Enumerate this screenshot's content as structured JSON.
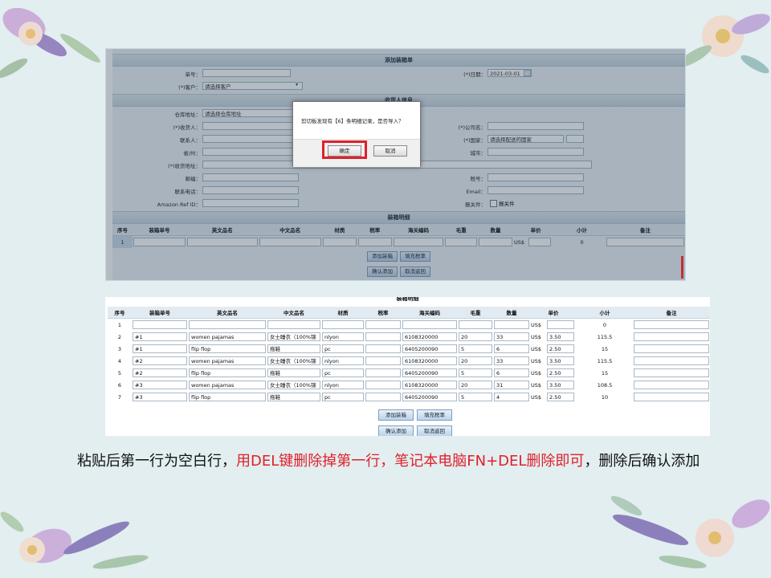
{
  "form": {
    "title": "添加装箱单",
    "order_no_label": "单号：",
    "date_label": "(*)日期：",
    "date_value": "2021-03-01",
    "customer_label": "(*)客户：",
    "customer_value": "请选择客户",
    "receiver_title": "收货人信息",
    "warehouse_label": "仓库地址：",
    "warehouse_value": "请选择仓库地址",
    "receiver_label": "(*)收货人：",
    "company_label": "(*)公司名：",
    "contact_label": "联系人：",
    "country_label": "(*)国家：",
    "country_value": "请选择配送的国家",
    "province_label": "省/州：",
    "city_label": "城市：",
    "address_label": "(*)收货地址：",
    "zip_label": "邮编：",
    "tax_no_label": "税号：",
    "phone_label": "联系电话：",
    "email_label": "Email：",
    "amazon_label": "Amazon Ref ID：",
    "customs_label": "报关件：",
    "customs_checkbox": "报关件",
    "detail_title": "装箱明细",
    "row1_index": "1",
    "row1_currency": "US$",
    "row1_subtotal": "0"
  },
  "dialog": {
    "message": "剪切板发现有【6】条明细记录，是否导入？",
    "ok": "确定",
    "cancel": "取消"
  },
  "table": {
    "title": "装箱明细",
    "headers": [
      "序号",
      "装箱单号",
      "英文品名",
      "中文品名",
      "材质",
      "税率",
      "海关编码",
      "毛重",
      "数量",
      "单价",
      "小计",
      "备注"
    ],
    "rows": [
      {
        "idx": "1",
        "box": "",
        "en": "",
        "cn": "",
        "mat": "",
        "tax": "",
        "hs": "",
        "weight": "",
        "qty": "",
        "cur": "US$",
        "price": "",
        "sub": "0"
      },
      {
        "idx": "2",
        "box": "#1",
        "en": "women pajamas",
        "cn": "女士睡衣（100%锦",
        "mat": "nlyon",
        "tax": "",
        "hs": "6108320000",
        "weight": "20",
        "qty": "33",
        "cur": "US$",
        "price": "3.50",
        "sub": "115.5"
      },
      {
        "idx": "3",
        "box": "#1",
        "en": "flip flop",
        "cn": "拖鞋",
        "mat": "pc",
        "tax": "",
        "hs": "6405200090",
        "weight": "5",
        "qty": "6",
        "cur": "US$",
        "price": "2.50",
        "sub": "15"
      },
      {
        "idx": "4",
        "box": "#2",
        "en": "women pajamas",
        "cn": "女士睡衣（100%锦",
        "mat": "nlyon",
        "tax": "",
        "hs": "6108320000",
        "weight": "20",
        "qty": "33",
        "cur": "US$",
        "price": "3.50",
        "sub": "115.5"
      },
      {
        "idx": "5",
        "box": "#2",
        "en": "flip flop",
        "cn": "拖鞋",
        "mat": "pc",
        "tax": "",
        "hs": "6405200090",
        "weight": "5",
        "qty": "6",
        "cur": "US$",
        "price": "2.50",
        "sub": "15"
      },
      {
        "idx": "6",
        "box": "#3",
        "en": "women pajamas",
        "cn": "女士睡衣（100%锦",
        "mat": "nlyon",
        "tax": "",
        "hs": "6108320000",
        "weight": "20",
        "qty": "31",
        "cur": "US$",
        "price": "3.50",
        "sub": "108.5"
      },
      {
        "idx": "7",
        "box": "#3",
        "en": "flip flop",
        "cn": "拖鞋",
        "mat": "pc",
        "tax": "",
        "hs": "6405200090",
        "weight": "5",
        "qty": "4",
        "cur": "US$",
        "price": "2.50",
        "sub": "10"
      }
    ]
  },
  "buttons": {
    "add_box": "添加装箱",
    "fill_tax": "填充税率",
    "confirm_add": "确认添加",
    "cancel_back": "取消返回"
  },
  "caption": {
    "part1": "粘贴后第一行为空白行，",
    "part2_red": "用DEL键删除掉第一行，笔记本电脑FN+DEL删除即可",
    "part3": "，删除后确认添加"
  },
  "colors": {
    "accent_red": "#e0202a",
    "background": "#e2eef0"
  },
  "icons": {
    "corner": "flower-bouquet-icon",
    "date": "calendar-icon",
    "dropdown": "chevron-down-icon"
  }
}
